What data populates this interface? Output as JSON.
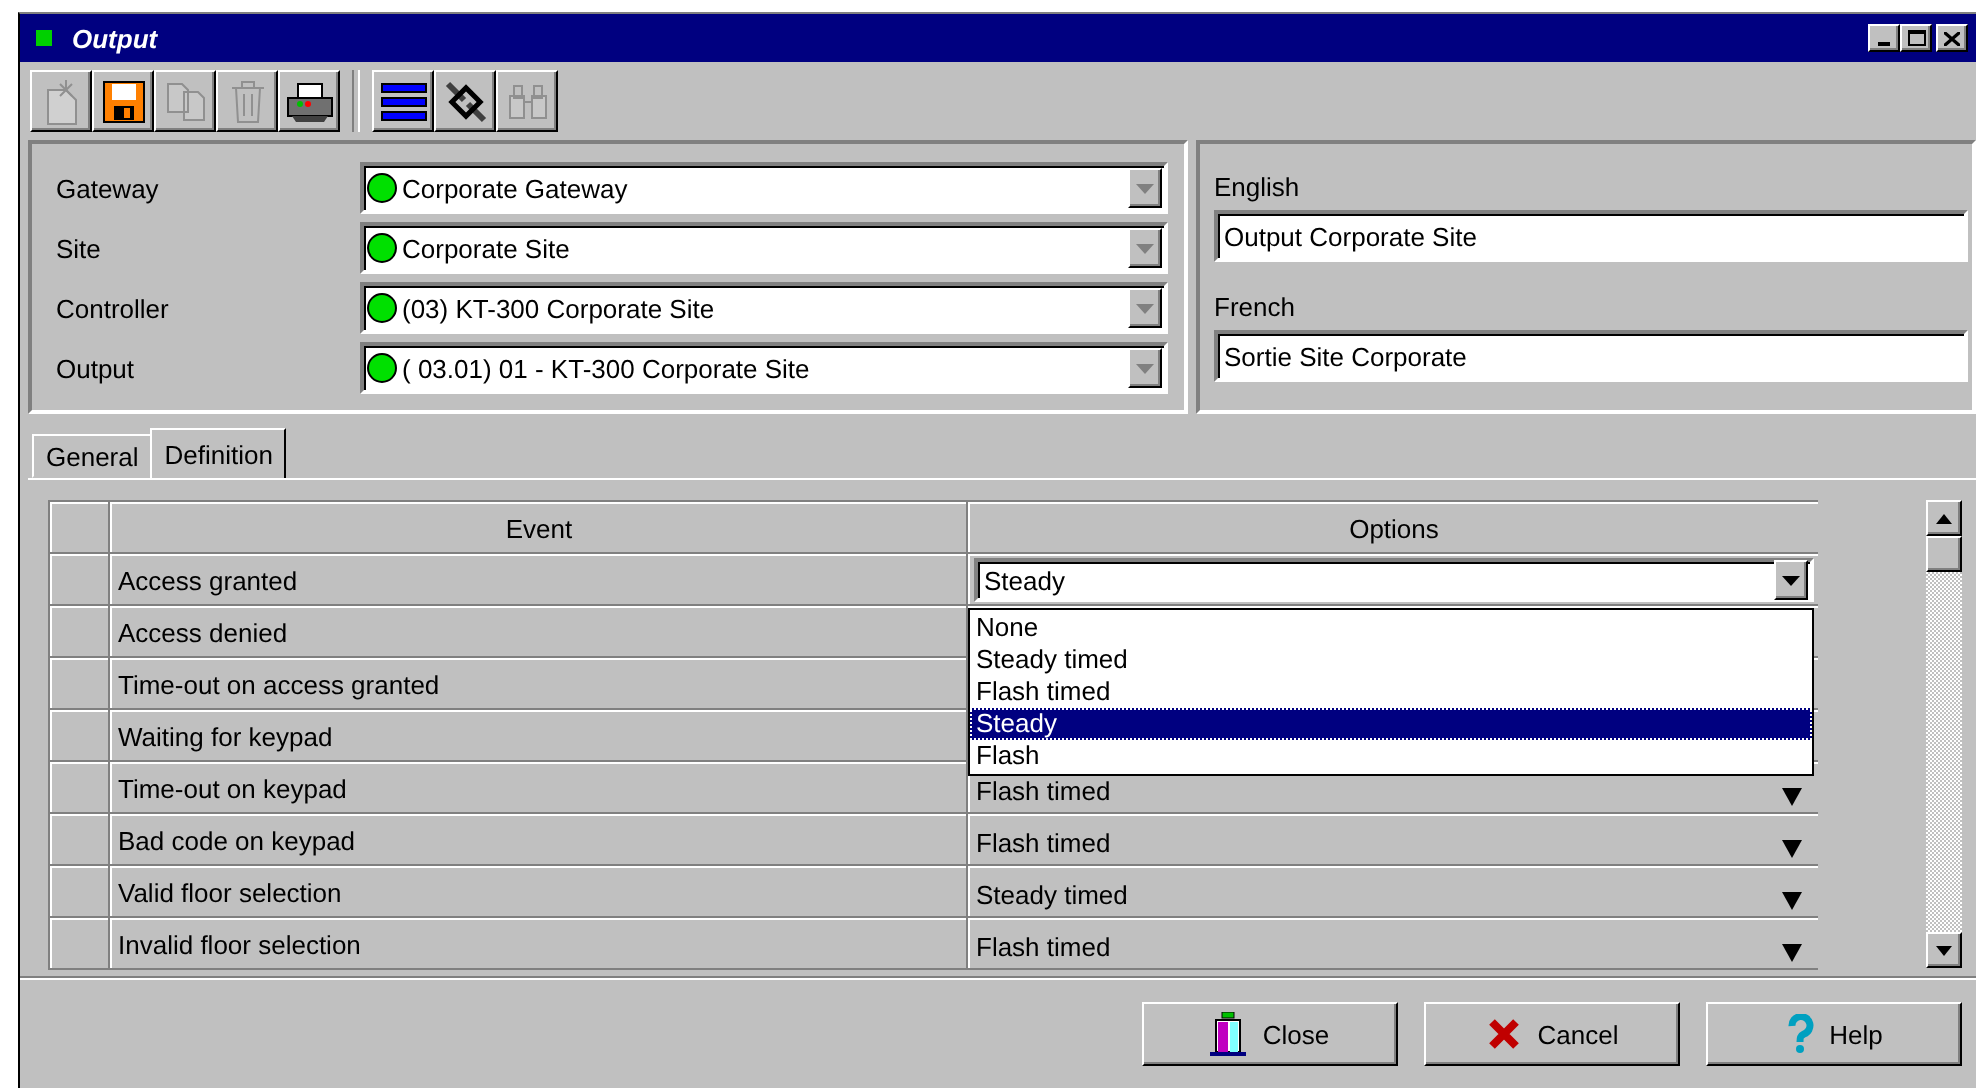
{
  "window": {
    "title": "Output"
  },
  "toolbar": {
    "groups": [
      [
        {
          "kind": "new",
          "disabled": true
        },
        {
          "kind": "save",
          "disabled": false
        },
        {
          "kind": "copy",
          "disabled": true
        },
        {
          "kind": "delete",
          "disabled": true
        },
        {
          "kind": "print",
          "disabled": false
        }
      ],
      [
        {
          "kind": "list",
          "disabled": false
        },
        {
          "kind": "link",
          "disabled": false
        },
        {
          "kind": "find",
          "disabled": true
        }
      ]
    ]
  },
  "selectors": [
    {
      "label": "Gateway",
      "value": "Corporate Gateway"
    },
    {
      "label": "Site",
      "value": "Corporate Site"
    },
    {
      "label": "Controller",
      "value": "(03) KT-300 Corporate Site"
    },
    {
      "label": "Output",
      "value": "( 03.01) 01 - KT-300 Corporate Site"
    }
  ],
  "names": [
    {
      "label": "English",
      "value": "Output Corporate Site"
    },
    {
      "label": "French",
      "value": "Sortie Site Corporate"
    }
  ],
  "tabs": [
    {
      "label": "General",
      "selected": false
    },
    {
      "label": "Definition",
      "selected": true
    }
  ],
  "grid": {
    "columns": [
      "Event",
      "Options"
    ],
    "rows": [
      {
        "event": "Access granted",
        "option": "Steady",
        "open": true
      },
      {
        "event": "Access denied",
        "open": false
      },
      {
        "event": "Time-out on access granted",
        "open": false
      },
      {
        "event": "Waiting for keypad",
        "open": false
      },
      {
        "event": "Time-out on keypad",
        "option": "Flash timed",
        "open": false
      },
      {
        "event": "Bad code on keypad",
        "option": "Flash timed",
        "open": false
      },
      {
        "event": "Valid floor selection",
        "option": "Steady timed",
        "open": false
      },
      {
        "event": "Invalid floor selection",
        "option": "Flash timed",
        "open": false
      }
    ],
    "dropdown": [
      {
        "label": "None",
        "selected": false
      },
      {
        "label": "Steady timed",
        "selected": false
      },
      {
        "label": "Flash timed",
        "selected": false
      },
      {
        "label": "Steady",
        "selected": true
      },
      {
        "label": "Flash",
        "selected": false
      }
    ]
  },
  "buttons": [
    {
      "kind": "close",
      "label": "Close"
    },
    {
      "kind": "cancel",
      "label": "Cancel"
    },
    {
      "kind": "help",
      "label": "Help"
    }
  ]
}
